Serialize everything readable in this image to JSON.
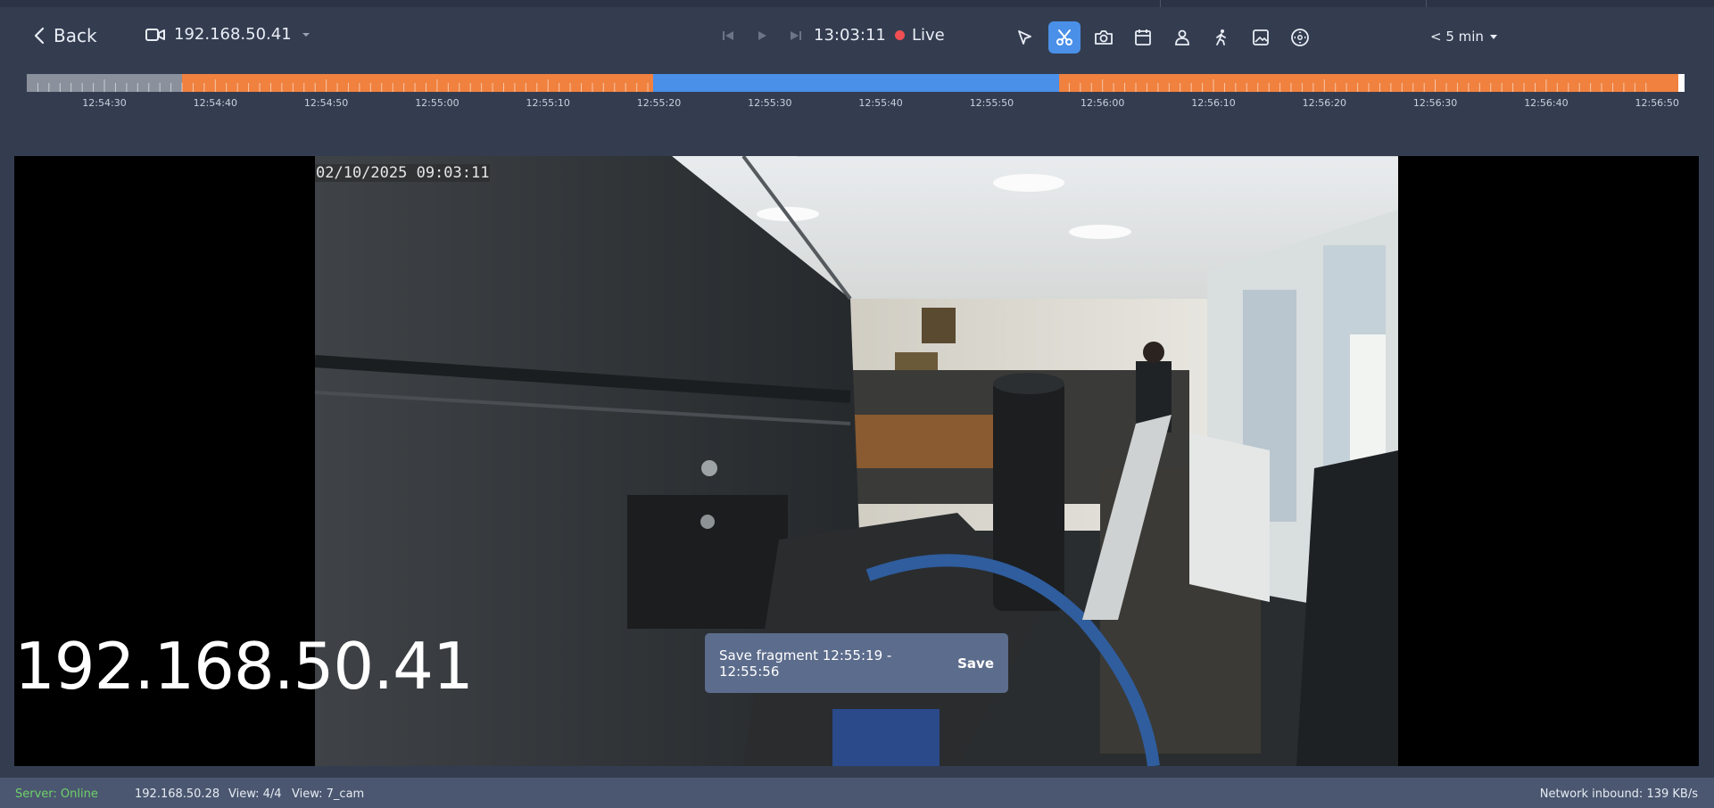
{
  "toolbar": {
    "back_label": "Back",
    "camera_selector": "192.168.50.41",
    "timecode": "13:03:11",
    "live_label": "Live",
    "interval_label": "< 5 min",
    "tools": [
      {
        "icon": "cursor-icon",
        "active": false
      },
      {
        "icon": "scissors-icon",
        "active": true
      },
      {
        "icon": "camera-icon",
        "active": false
      },
      {
        "icon": "calendar-icon",
        "active": false
      },
      {
        "icon": "person-icon",
        "active": false
      },
      {
        "icon": "walking-person-icon",
        "active": false
      },
      {
        "icon": "image-icon",
        "active": false
      },
      {
        "icon": "joystick-icon",
        "active": false
      }
    ]
  },
  "timeline": {
    "tick_labels": [
      "12:54:30",
      "12:54:40",
      "12:54:50",
      "12:55:00",
      "12:55:10",
      "12:55:20",
      "12:55:30",
      "12:55:40",
      "12:55:50",
      "12:56:00",
      "12:56:10",
      "12:56:20",
      "12:56:30",
      "12:56:40",
      "12:56:50"
    ],
    "selection_start": "12:55:19",
    "selection_end": "12:55:56",
    "colors": {
      "recorded": "#f0813f",
      "no_record": "#8a909c",
      "selection": "#4a8fe8"
    }
  },
  "video": {
    "osd_timestamp": "02/10/2025 09:03:11",
    "camera_label": "192.168.50.41"
  },
  "fragment": {
    "text": "Save fragment 12:55:19 - 12:55:56",
    "save_label": "Save"
  },
  "status": {
    "server": "Server: Online",
    "ip": "192.168.50.28",
    "view_count": "View: 4/4",
    "view_name": "View: 7_cam",
    "network": "Network inbound: 139 KB/s"
  }
}
